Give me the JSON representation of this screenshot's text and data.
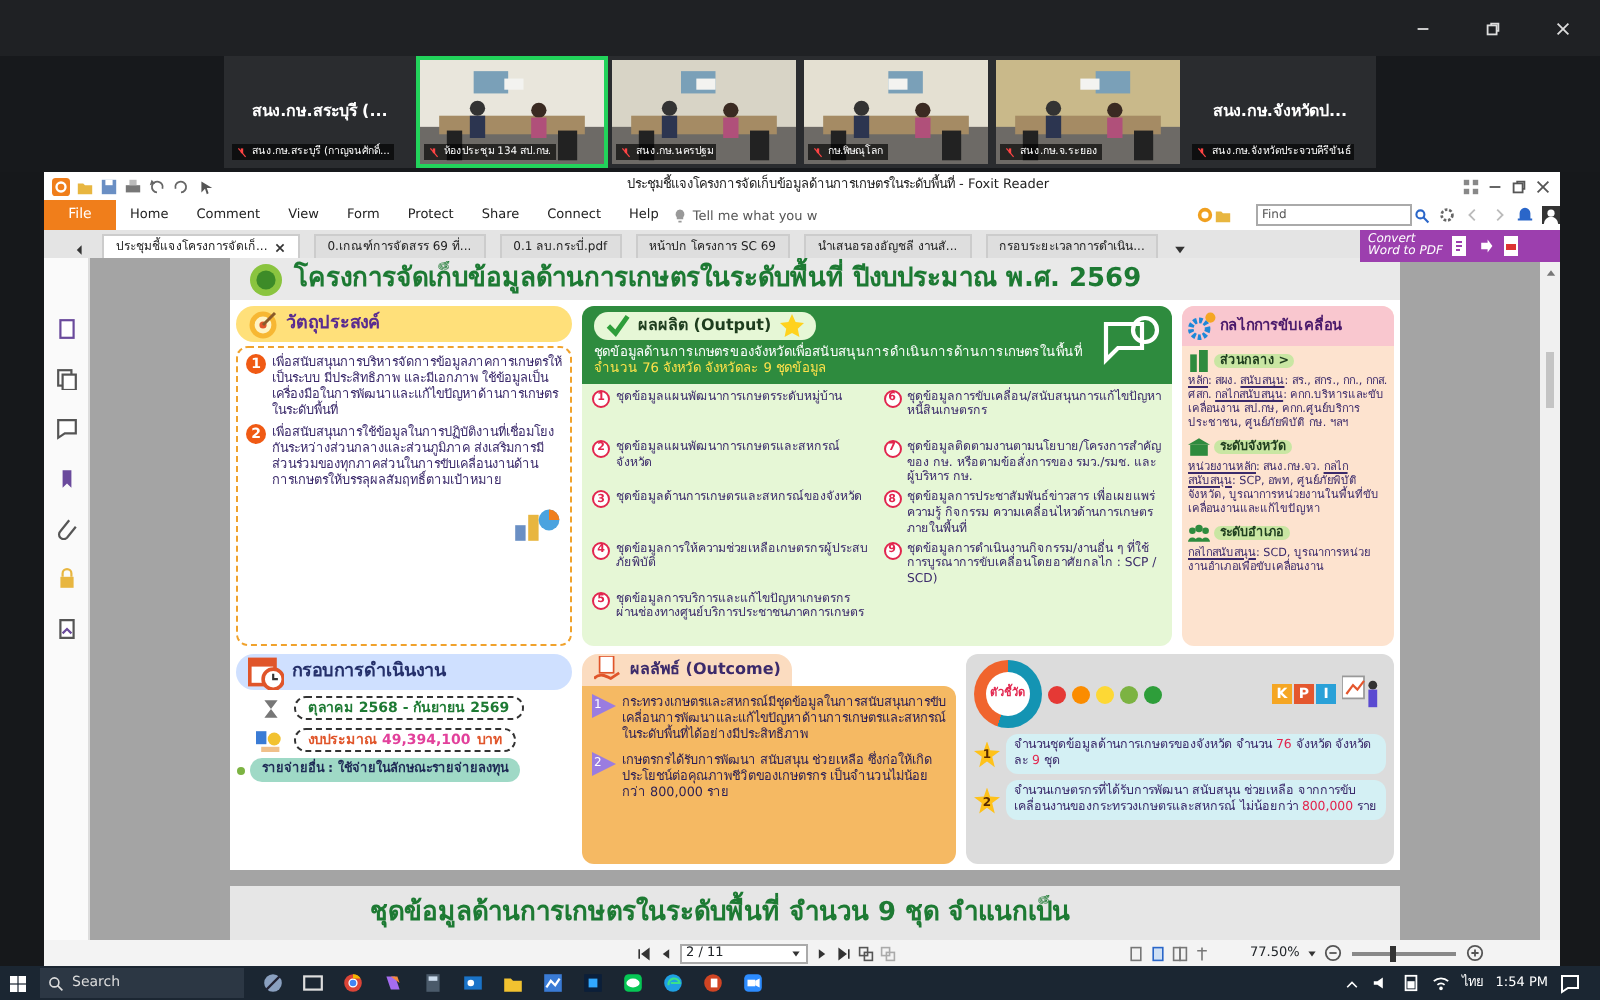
{
  "meeting": {
    "tiles": [
      {
        "kind": "name",
        "title": "สนง.กษ.สระบุรี (...",
        "label": "สนง.กษ.สระบุรี (กาญจนศักดิ์...",
        "selected": false
      },
      {
        "kind": "video",
        "label": "ห้องประชุม 134 สป.กษ.",
        "selected": true
      },
      {
        "kind": "video",
        "label": "สนง.กษ.นครปฐม",
        "selected": false
      },
      {
        "kind": "video",
        "label": "กษ.พิษณุโลก",
        "selected": false
      },
      {
        "kind": "video",
        "label": "สนง.กษ.จ.ระยอง",
        "selected": false
      },
      {
        "kind": "name",
        "title": "สนง.กษ.จังหวัดป...",
        "label": "สนง.กษ.จังหวัดประจวบคีรีขันธ์",
        "selected": false
      }
    ]
  },
  "reader": {
    "title": "ประชุมชี้แจงโครงการจัดเก็บข้อมูลด้านการเกษตรในระดับพื้นที่ - Foxit Reader",
    "file_button": "File",
    "menu": [
      "Home",
      "Comment",
      "View",
      "Form",
      "Protect",
      "Share",
      "Connect",
      "Help"
    ],
    "tell_me": {
      "placeholder": "Tell me what you w"
    },
    "find": {
      "placeholder": "Find"
    },
    "tabs": [
      {
        "label": "ประชุมชี้แจงโครงการจัดเก็...",
        "selected": true
      },
      {
        "label": "0.เกณฑ์การจัดสรร 69 ที่...",
        "selected": false
      },
      {
        "label": "0.1 ลบ.กระบี่.pdf",
        "selected": false
      },
      {
        "label": "หน้าปก โครงการ SC 69",
        "selected": false
      },
      {
        "label": "นำเสนอรองอัญชลี งานสั...",
        "selected": false
      },
      {
        "label": "กรอบระยะเวลาการดำเนิน...",
        "selected": false
      }
    ],
    "convert": [
      "Convert",
      "Word to PDF"
    ],
    "page_field": "2 / 11",
    "zoom": {
      "reading": "77.50%",
      "level": 0.37
    }
  },
  "document": {
    "heading": "โครงการจัดเก็บข้อมูลด้านการเกษตรในระดับพื้นที่ ปีงบประมาณ พ.ศ. 2569",
    "objectives": {
      "title": "วัตถุประสงค์",
      "items": [
        {
          "num": "1",
          "text": "เพื่อสนับสนุนการบริหารจัดการข้อมูลภาคการเกษตรให้เป็นระบบ มีประสิทธิภาพ และมีเอกภาพ ใช้ข้อมูลเป็นเครื่องมือในการพัฒนาและแก้ไขปัญหาด้านการเกษตรในระดับพื้นที่"
        },
        {
          "num": "2",
          "text": "เพื่อสนับสนุนการใช้ข้อมูลในการปฏิบัติงานที่เชื่อมโยงกันระหว่างส่วนกลางและส่วนภูมิภาค ส่งเสริมการมีส่วนร่วมของทุกภาคส่วนในการขับเคลื่อนงานด้านการเกษตรให้บรรลุผลสัมฤทธิ์ตามเป้าหมาย"
        }
      ]
    },
    "framework": {
      "title": "กรอบการดำเนินงาน",
      "period": "ตุลาคม 2568 - กันยายน 2569",
      "budget_label": "งบประมาณ",
      "budget_amount": "49,394,100",
      "budget_unit": "บาท",
      "note": "รายจ่ายอื่น : ใช้จ่ายในลักษณะรายจ่ายลงทุน"
    },
    "output": {
      "title": "ผลผลิต (Output)",
      "summary": "ชุดข้อมูลด้านการเกษตรของจังหวัดเพื่อสนับสนุนการดำเนินการด้านการเกษตรในพื้นที่ **จำนวน 76 จังหวัด จังหวัดละ 9 ชุดข้อมูล**",
      "items": [
        {
          "num": "1",
          "text": "ชุดข้อมูลแผนพัฒนาการเกษตรระดับหมู่บ้าน"
        },
        {
          "num": "2",
          "text": "ชุดข้อมูลแผนพัฒนาการเกษตรและสหกรณ์จังหวัด"
        },
        {
          "num": "3",
          "text": "ชุดข้อมูลด้านการเกษตรและสหกรณ์ของจังหวัด"
        },
        {
          "num": "4",
          "text": "ชุดข้อมูลการให้ความช่วยเหลือเกษตรกรผู้ประสบภัยพิบัติ"
        },
        {
          "num": "5",
          "text": "ชุดข้อมูลการบริการและแก้ไขปัญหาเกษตรกรผ่านช่องทางศูนย์บริการประชาชนภาคการเกษตร"
        },
        {
          "num": "6",
          "text": "ชุดข้อมูลการขับเคลื่อน/สนับสนุนการแก้ไขปัญหาหนี้สินเกษตรกร"
        },
        {
          "num": "7",
          "text": "ชุดข้อมูลติดตามงานตามนโยบาย/โครงการสำคัญของ กษ. หรือตามข้อสั่งการของ รมว./รมช. และผู้บริหาร กษ."
        },
        {
          "num": "8",
          "text": "ชุดข้อมูลการประชาสัมพันธ์ข่าวสาร เพื่อเผยแพร่ความรู้ กิจกรรม ความเคลื่อนไหวด้านการเกษตรภายในพื้นที่"
        },
        {
          "num": "9",
          "text": "ชุดข้อมูลการดำเนินงานกิจกรรม/งานอื่น ๆ ที่ใช้การบูรณาการขับเคลื่อนโดยอาศัยกลไก : SCP / SCD)"
        }
      ]
    },
    "mechanism": {
      "title": "กลไกการขับเคลื่อน",
      "levels": [
        {
          "kind": "central",
          "name": "ส่วนกลาง >",
          "entries": [
            {
              "label": "หลัก",
              "text": ": สผง."
            },
            {
              "label": "สนับสนุน",
              "text": ": สร., สกร., กก., กกส. ศสก."
            },
            {
              "label": "กลไกสนับสนุน",
              "text": ": คกก.บริหารและขับเคลื่อนงาน สป.กษ, คกก.ศูนย์บริการประชาชน, ศูนย์ภัยพิบัติ กษ. ฯลฯ"
            }
          ]
        },
        {
          "kind": "province",
          "name": "ระดับจังหวัด",
          "entries": [
            {
              "label": "หน่วยงานหลัก",
              "text": ": สนง.กษ.จว."
            },
            {
              "label": "กลไกสนับสนุน",
              "text": ": SCP, อพท, ศูนย์ภัยพิบัติจังหวัด, บูรณาการหน่วยงานในพื้นที่ขับเคลื่อนงานและแก้ไขปัญหา"
            }
          ]
        },
        {
          "kind": "district",
          "name": "ระดับอำเภอ",
          "entries": [
            {
              "label": "กลไกสนับสนุน",
              "text": ": SCD, บูรณาการหน่วยงานอำเภอเพื่อขับเคลื่อนงาน"
            }
          ]
        }
      ]
    },
    "outcome": {
      "title": "ผลลัพธ์ (Outcome)",
      "items": [
        {
          "num": "1",
          "text": "กระทรวงเกษตรและสหกรณ์มีชุดข้อมูลในการสนับสนุนการขับเคลื่อนการพัฒนาและแก้ไขปัญหาด้านการเกษตรและสหกรณ์ในระดับพื้นที่ได้อย่างมีประสิทธิภาพ"
        },
        {
          "num": "2",
          "text": "เกษตรกรได้รับการพัฒนา สนับสนุน ช่วยเหลือ ซึ่งก่อให้เกิดประโยชน์ต่อคุณภาพชีวิตของเกษตรกร เป็นจำนวนไม่น้อยกว่า 800,000 ราย"
        }
      ]
    },
    "indicators": {
      "title": "ตัวชี้วัด",
      "faces": [
        {
          "color": "#e53935"
        },
        {
          "color": "#fb8c00"
        },
        {
          "color": "#fdd835"
        },
        {
          "color": "#7cb342"
        },
        {
          "color": "#2e9e3a"
        }
      ],
      "kpi_letters": [
        "K",
        "P",
        "I"
      ],
      "items": [
        {
          "num": "1",
          "text": "จำนวนชุดข้อมูลด้านการเกษตรของจังหวัด จำนวน **76** จังหวัด จังหวัดละ **9** ชุด"
        },
        {
          "num": "2",
          "text": "จำนวนเกษตรกรที่ได้รับการพัฒนา สนับสนุน ช่วยเหลือ จากการขับเคลื่อนงานของกระทรวงเกษตรและสหกรณ์ ไม่น้อยกว่า **800,000** ราย"
        }
      ]
    },
    "next_heading": "ชุดข้อมูลด้านการเกษตรในระดับพื้นที่ จำนวน 9 ชุด จำแนกเป็น"
  },
  "taskbar": {
    "search": "Search",
    "language": "ไทย",
    "time": "1:54 PM"
  }
}
